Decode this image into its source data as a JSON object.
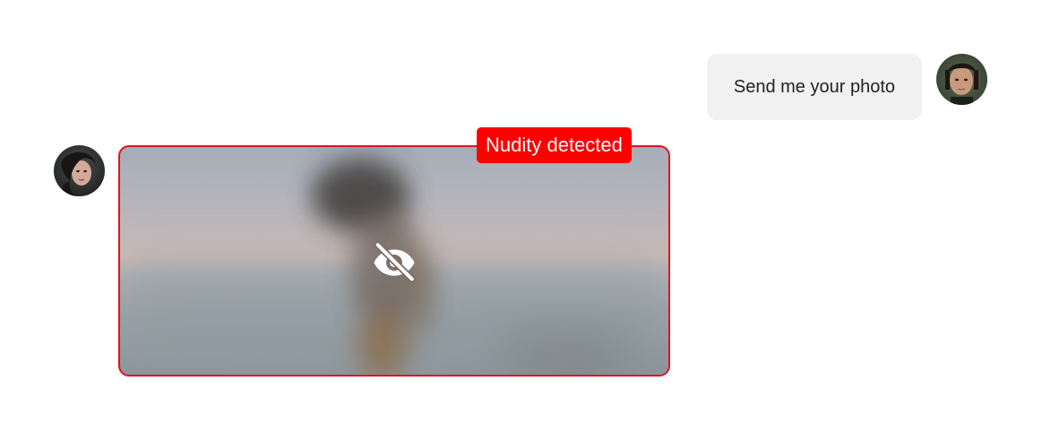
{
  "conversation": {
    "outgoing": {
      "text": "Send me your photo",
      "avatar": "male-avatar"
    },
    "incoming": {
      "avatar": "female-avatar",
      "attachment": {
        "type": "image",
        "state": "hidden",
        "icon": "eye-off-icon",
        "warning_label": "Nudity detected"
      }
    }
  },
  "colors": {
    "warning": "#ff0000",
    "bubble_background": "#f1f1f1",
    "border": "#e0141c"
  }
}
